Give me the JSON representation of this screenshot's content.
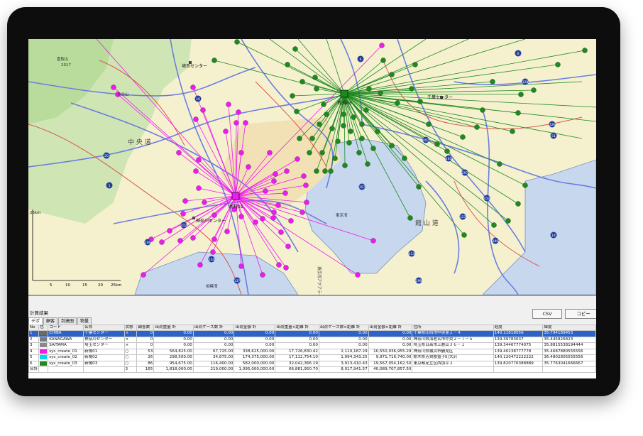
{
  "map": {
    "labels": {
      "chuo_road": "中 央 道",
      "kanagawa_center": "神奈川センター",
      "chiba_center": "千葉センター",
      "saitama_center": "埼玉センター",
      "shinki01": "新規01",
      "shinki03": "新規03",
      "tokyo_bay": "東京湾",
      "aqualine": "東京湾アクアライン",
      "sagami_bay": "相模湾",
      "kenoyama_road": "館 山 道",
      "city_yokohama": "横浜",
      "mountain1": "雲取山",
      "mountain1_elev": "2017",
      "mountain2": "大岳山"
    },
    "scale": {
      "unit": "25km",
      "ticks": [
        "5",
        "10",
        "15",
        "20",
        "25km"
      ]
    },
    "route_numbers": [
      "16",
      "246",
      "1",
      "134",
      "412",
      "20",
      "137",
      "140",
      "413",
      "299",
      "4",
      "6",
      "14",
      "51",
      "126",
      "128",
      "297",
      "465",
      "410",
      "127",
      "357",
      "407"
    ],
    "colors": {
      "magenta": "#ee1aee",
      "green": "#1e8a1e",
      "water": "#c7d8ee",
      "land": "#f5f1cf"
    }
  },
  "panel": {
    "title": "計算結果",
    "csv_button": "CSV",
    "copy_button": "コピー",
    "tabs": [
      "デポ",
      "顧客",
      "到達圏",
      "物量"
    ],
    "columns": [
      "No",
      "色",
      "コード",
      "名称",
      "状態",
      "顧客数",
      "出荷重量 計",
      "出荷ケース数 計",
      "出荷金額 計",
      "出荷重量×距離 計",
      "出荷ケース数×距離 計",
      "出荷金額×距離 計",
      "住所",
      "経度",
      "緯度"
    ],
    "rows": [
      {
        "no": "1",
        "color": "#6a6a6a",
        "code": "CHIBA",
        "name": "千葉センター",
        "state": "×",
        "cust": "0",
        "w": "0.00",
        "c": "0.00",
        "m": "0.00",
        "wd": "0.00",
        "cd": "0.00",
        "md": "0.00",
        "addr": "千葉県印西市中央東２－４",
        "lng": "140.11618056",
        "lat": "35.794189453"
      },
      {
        "no": "2",
        "color": "#7a7a7a",
        "code": "KANAGAWA",
        "name": "神奈川センター",
        "state": "×",
        "cust": "0",
        "w": "0.00",
        "c": "0.00",
        "m": "0.00",
        "wd": "0.00",
        "cd": "0.00",
        "md": "0.00",
        "addr": "神奈川県海老名市中央２－７－５",
        "lng": "139.39783637",
        "lat": "35.445826823"
      },
      {
        "no": "3",
        "color": "#8a8a8a",
        "code": "SAITAMA",
        "name": "埼玉センター",
        "state": "×",
        "cust": "0",
        "w": "0.00",
        "c": "0.00",
        "m": "0.00",
        "wd": "0.00",
        "cd": "0.00",
        "md": "0.00",
        "addr": "埼玉県日高市上鹿山３６－１",
        "lng": "139.34467774075",
        "lat": "35.8815538194444"
      },
      {
        "no": "4",
        "color": "#ee1aee",
        "code": "sys_create_01",
        "name": "新規01",
        "state": "○",
        "cust": "53",
        "w": "564,825.00",
        "c": "67,725.00",
        "m": "338,625,000.00",
        "wd": "17,726,830.42",
        "cd": "2,110,187.29",
        "md": "10,550,936,955.29",
        "addr": "神奈川県横浜市鶴見区",
        "lng": "139.40238777778",
        "lat": "35.4687880555556"
      },
      {
        "no": "5",
        "color": "#00d8e8",
        "code": "sys_create_02",
        "name": "新規02",
        "state": "○",
        "cust": "26",
        "w": "298,500.00",
        "c": "34,875.00",
        "m": "174,375,000.00",
        "wd": "17,112,754.10",
        "cd": "1,994,343.25",
        "md": "9,971,716,740.00",
        "addr": "栃木県芳賀郡益子町大沢",
        "lng": "140.120472222222",
        "lat": "36.4802805555556"
      },
      {
        "no": "6",
        "color": "#1e8a1e",
        "code": "sys_create_03",
        "name": "新規03",
        "state": "○",
        "cust": "86",
        "w": "954,675.00",
        "c": "116,400.00",
        "m": "582,000,000.00",
        "wd": "32,042,366.19",
        "cd": "3,913,410.43",
        "md": "19,567,054,162.50",
        "addr": "東京都足立区西加平２",
        "lng": "139.820776388889",
        "lat": "35.7763041666667"
      },
      {
        "no": "合計",
        "color": "",
        "code": "",
        "name": "",
        "state": "3",
        "cust": "165",
        "w": "1,818,000.00",
        "c": "219,000.00",
        "m": "1,095,000,000.00",
        "wd": "66,881,950.70",
        "cd": "8,017,941.57",
        "md": "40,089,707,857.50",
        "addr": "",
        "lng": "",
        "lat": ""
      }
    ]
  }
}
